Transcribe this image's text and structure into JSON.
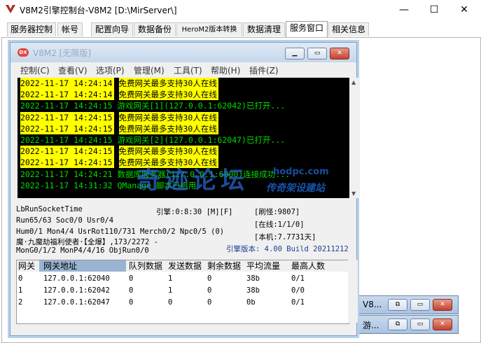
{
  "window": {
    "title": "V8M2引擎控制台-V8M2 [D:\\MirServer\\]"
  },
  "tabs": [
    "服务器控制",
    "帐号",
    "配置向导",
    "数据备份",
    "HeroM2版本转换",
    "数据清理",
    "服务窗口",
    "相关信息"
  ],
  "child": {
    "title": "V8M2 [无限版]",
    "menu": [
      "控制(C)",
      "查看(V)",
      "选项(P)",
      "管理(M)",
      "工具(T)",
      "帮助(H)",
      "插件(Z)"
    ]
  },
  "log": [
    {
      "ts": "2022-11-17 14:24:14",
      "msg": "免费网关最多支持30人在线",
      "style": "y"
    },
    {
      "ts": "2022-11-17 14:24:14",
      "msg": "免费网关最多支持30人在线",
      "style": "y"
    },
    {
      "ts": "2022-11-17 14:24:15",
      "msg": "游戏网关[1](127.0.0.1:62042)已打开...",
      "style": "g"
    },
    {
      "ts": "2022-11-17 14:24:15",
      "msg": "免费网关最多支持30人在线",
      "style": "y"
    },
    {
      "ts": "2022-11-17 14:24:15",
      "msg": "免费网关最多支持30人在线",
      "style": "y"
    },
    {
      "ts": "2022-11-17 14:24:15",
      "msg": "游戏网关[2](127.0.0.1:62047)已打开...",
      "style": "g"
    },
    {
      "ts": "2022-11-17 14:24:15",
      "msg": "免费网关最多支持30人在线",
      "style": "y"
    },
    {
      "ts": "2022-11-17 14:24:15",
      "msg": "免费网关最多支持30人在线",
      "style": "y"
    },
    {
      "ts": "2022-11-17 14:24:21",
      "msg": "数据库服务器(127.0.0.1:6000)连接成功...",
      "style": "g"
    },
    {
      "ts": "2022-11-17 14:31:32",
      "msg": "QManage 脚本已启用",
      "style": "g"
    }
  ],
  "stats": {
    "line1": "LbRunSocketTime",
    "engine": "引擎:0:8:30 [M][F]",
    "refresh": "[刷怪:9807]",
    "line2": "Run65/63 Soc0/0 Usr0/4",
    "online": "[在线:1/1/0]",
    "line3": "Hum0/1 Mon4/4 UsrRot110/731 Merch0/2 Npc0/5 (0)",
    "local": "[本机:7.7731天]",
    "line4": "魔·九魔劫福利使者·【全爆】,173/2272 -",
    "version": "引擎版本: 4.00 Build 20211212",
    "line5": "MonG0/1/2 MonP4/4/16 ObjRun0/0"
  },
  "grid": {
    "headers": [
      "网关",
      "网关地址",
      "队列数据",
      "发送数据",
      "剩余数据",
      "平均流量",
      "最高人数"
    ],
    "rows": [
      [
        "0",
        "127.0.0.1:62040",
        "0",
        "1",
        "0",
        "38b",
        "0/1"
      ],
      [
        "1",
        "127.0.0.1:62042",
        "0",
        "1",
        "0",
        "38b",
        "0/0"
      ],
      [
        "2",
        "127.0.0.1:62047",
        "0",
        "0",
        "0",
        "0b",
        "0/1"
      ]
    ]
  },
  "minimized": [
    "V8...",
    "游..."
  ],
  "watermark": {
    "main": "奇迹论坛",
    "url": "hodpc.com",
    "sub": "传奇架设建站"
  }
}
